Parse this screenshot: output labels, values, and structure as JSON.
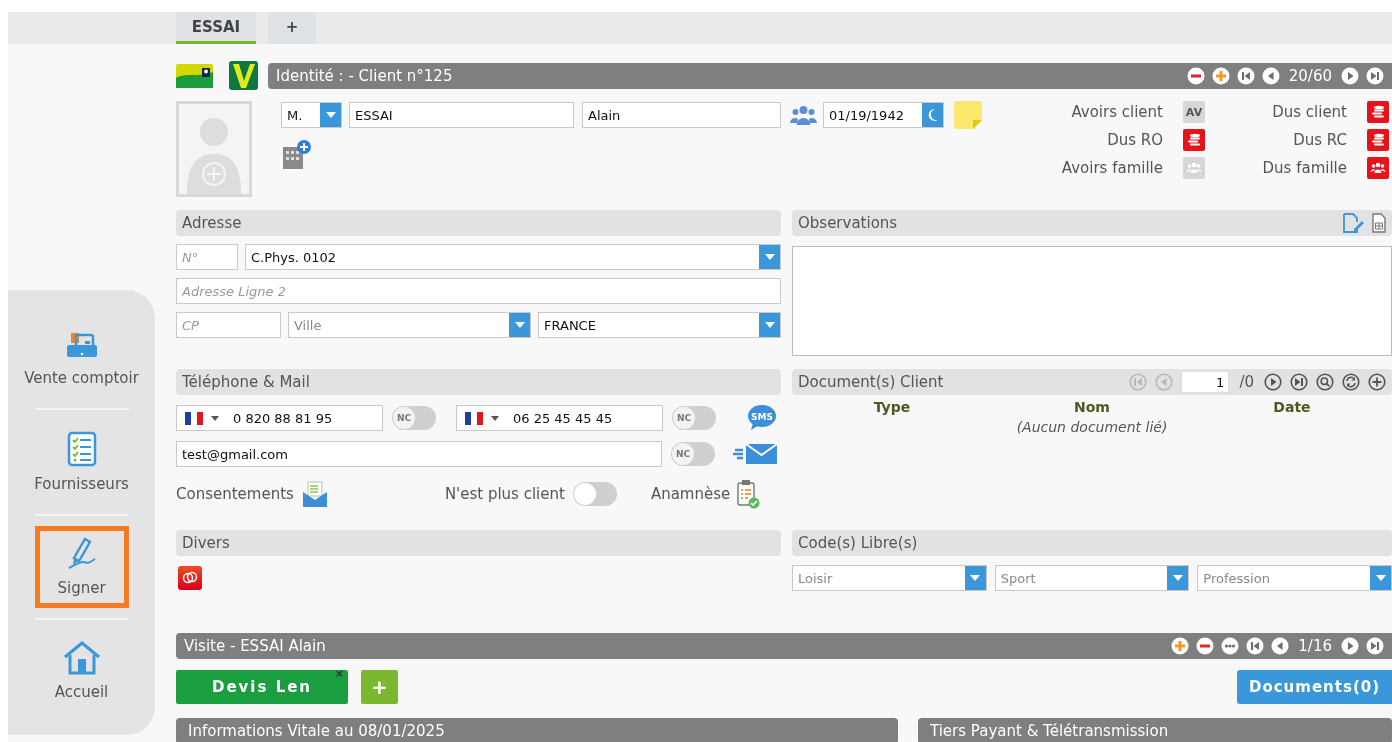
{
  "tabs": [
    {
      "label": "ESSAI",
      "selected": true
    },
    {
      "label": "+",
      "selected": false
    }
  ],
  "identity": {
    "title": "Identité : - Client n°125",
    "controls": [
      {
        "kind": "minus"
      },
      {
        "kind": "plus"
      },
      {
        "kind": "first"
      },
      {
        "kind": "prev"
      },
      {
        "kind": "counter",
        "text": "20/60"
      },
      {
        "kind": "next"
      },
      {
        "kind": "last"
      }
    ],
    "civility": "M.",
    "last_name": "ESSAI",
    "first_name": "Alain",
    "birth_date": "01/19/1942",
    "balances": [
      {
        "label": "Avoirs client",
        "kind": "av",
        "icon_text": "AV",
        "active": false
      },
      {
        "label": "Dus client",
        "kind": "coins",
        "active": true
      },
      {
        "label": "Dus RO",
        "kind": "coins",
        "active": true
      },
      {
        "label": "Dus RC",
        "kind": "coins",
        "active": true
      },
      {
        "label": "Avoirs famille",
        "kind": "family",
        "active": false
      },
      {
        "label": "Dus famille",
        "kind": "family",
        "active": true
      }
    ]
  },
  "address": {
    "title": "Adresse",
    "number_placeholder": "N°",
    "street": "C.Phys. 0102",
    "line2_placeholder": "Adresse Ligne 2",
    "cp_placeholder": "CP",
    "city_placeholder": "Ville",
    "country": "FRANCE"
  },
  "observations": {
    "title": "Observations"
  },
  "contact": {
    "title": "Téléphone & Mail",
    "phones": [
      {
        "number": "0 820 88 81 95",
        "nc_label": "NC",
        "nc_on": false
      },
      {
        "number": "06 25 45 45 45",
        "nc_label": "NC",
        "nc_on": false
      }
    ],
    "sms_label": "SMS",
    "email": "test@gmail.com",
    "email_nc_label": "NC",
    "email_nc_on": false,
    "consents": "Consentements",
    "not_client": {
      "label": "N'est plus client",
      "on": false
    },
    "anamnesis": "Anamnèse"
  },
  "documents": {
    "title": "Document(s) Client",
    "controls": [
      {
        "kind": "first",
        "disabled": true
      },
      {
        "kind": "prev",
        "disabled": true
      },
      {
        "kind": "page",
        "text": "1"
      },
      {
        "kind": "counter",
        "text": "/0"
      },
      {
        "kind": "next",
        "disabled": false
      },
      {
        "kind": "last",
        "disabled": false
      },
      {
        "kind": "search",
        "disabled": false
      },
      {
        "kind": "refresh",
        "disabled": false
      },
      {
        "kind": "add",
        "disabled": false
      }
    ],
    "columns": [
      "Type",
      "Nom",
      "Date"
    ],
    "empty": "(Aucun document lié)"
  },
  "misc": {
    "title": "Divers"
  },
  "free_codes": {
    "title": "Code(s) Libre(s)",
    "fields": [
      {
        "placeholder": "Loisir"
      },
      {
        "placeholder": "Sport"
      },
      {
        "placeholder": "Profession"
      }
    ]
  },
  "visit": {
    "title": "Visite - ESSAI Alain",
    "controls": [
      {
        "kind": "plus"
      },
      {
        "kind": "minus"
      },
      {
        "kind": "more"
      },
      {
        "kind": "first"
      },
      {
        "kind": "prev"
      },
      {
        "kind": "counter",
        "text": "1/16"
      },
      {
        "kind": "next"
      },
      {
        "kind": "last"
      }
    ],
    "quote_tab": "Devis Len",
    "quote_close": "×",
    "add_label": "+",
    "documents_button": "Documents(0)"
  },
  "bottom_panels": [
    {
      "title": "Informations Vitale au 08/01/2025"
    },
    {
      "title": "Tiers Payant & Télétransmission"
    }
  ],
  "sidebar": {
    "items": [
      {
        "label": "Vente comptoir",
        "kind": "register",
        "selected": false
      },
      {
        "label": "Fournisseurs",
        "kind": "checklist",
        "selected": false
      },
      {
        "label": "Signer",
        "kind": "pen",
        "selected": true
      },
      {
        "label": "Accueil",
        "kind": "home",
        "selected": false
      }
    ]
  }
}
